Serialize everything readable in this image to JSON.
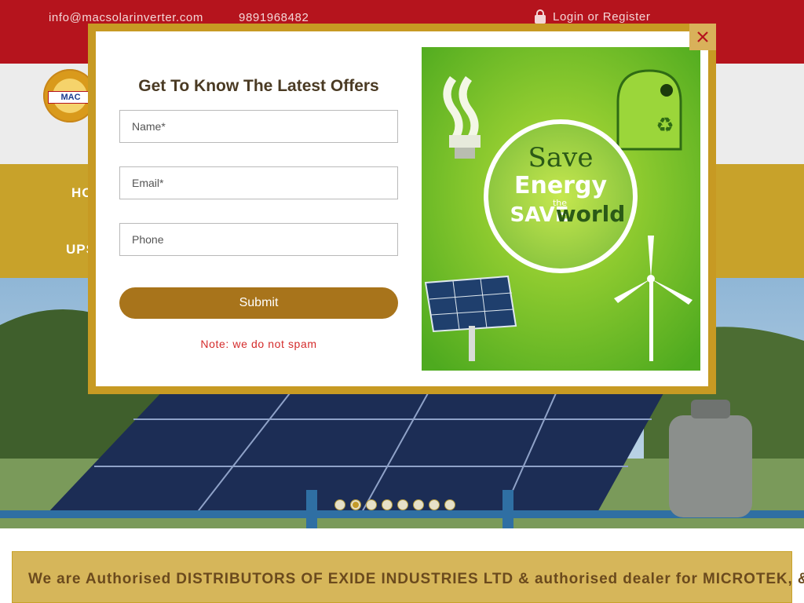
{
  "topbar": {
    "email": "info@macsolarinverter.com",
    "phone": "9891968482",
    "login_label": "Login or Register"
  },
  "logo": {
    "text": "MAC"
  },
  "nav": {
    "item1": "HO",
    "item2": "UPS"
  },
  "popup": {
    "title": "Get To Know The Latest Offers",
    "name_placeholder": "Name*",
    "email_placeholder": "Email*",
    "phone_placeholder": "Phone",
    "submit_label": "Submit",
    "note": "Note: we do not spam",
    "promo": {
      "line1": "Save",
      "line2": "Energy",
      "line3": "SAVE",
      "line3_small": "the",
      "line4": "world"
    }
  },
  "slider": {
    "dots": 8,
    "active_index": 1
  },
  "banner": {
    "text": "We are Authorised DISTRIBUTORS OF EXIDE INDUSTRIES LTD & authorised dealer for MICROTEK, &"
  },
  "colors": {
    "topbar": "#b5141d",
    "gold": "#c8a22a",
    "brown_button": "#a8741b",
    "note_red": "#d42b2b"
  }
}
